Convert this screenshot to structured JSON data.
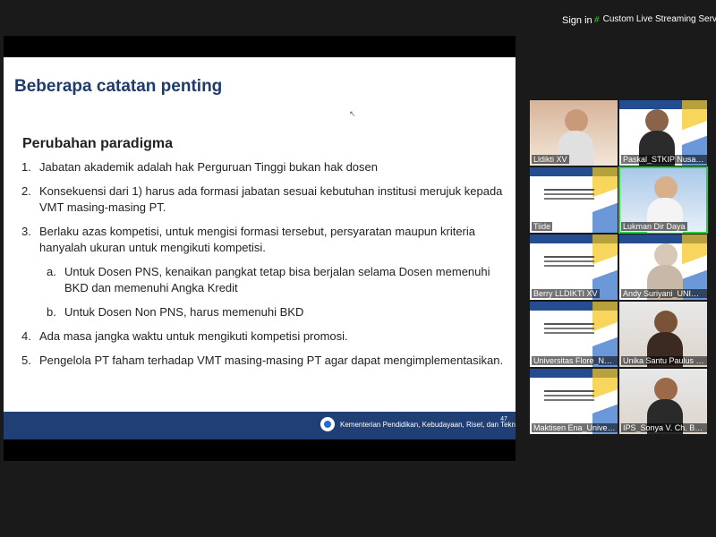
{
  "top_bar": {
    "signin_label": "Sign in",
    "live_label": "Custom Live Streaming Service",
    "live_icon": "signal-wave-icon",
    "chevron_icon": "chevron-down-icon"
  },
  "slide": {
    "title": "Beberapa catatan penting",
    "subtitle": "Perubahan paradigma",
    "items": [
      {
        "num": "1.",
        "text": "Jabatan akademik adalah hak Perguruan Tinggi bukan hak dosen"
      },
      {
        "num": "2.",
        "text": "Konsekuensi dari 1) harus ada formasi jabatan sesuai kebutuhan institusi merujuk kepada VMT masing-masing PT."
      },
      {
        "num": "3.",
        "text": "Berlaku azas kompetisi, untuk mengisi formasi tersebut, persyaratan maupun kriteria hanyalah ukuran untuk mengikuti kompetisi."
      },
      {
        "num": "4.",
        "text": "Ada masa jangka waktu untuk mengikuti kompetisi promosi."
      },
      {
        "num": "5.",
        "text": "Pengelola PT faham terhadap VMT masing-masing PT agar dapat mengimplementasikan."
      }
    ],
    "subitems": [
      {
        "num": "a.",
        "text": "Untuk Dosen PNS, kenaikan pangkat tetap bisa berjalan selama Dosen memenuhi BKD dan memenuhi Angka Kredit"
      },
      {
        "num": "b.",
        "text": "Untuk Dosen Non PNS, harus memenuhi BKD"
      }
    ],
    "footer_text": "Kementerian Pendidikan, Kebudayaan, Riset, dan Teknologi",
    "page_number": "47"
  },
  "participants": [
    {
      "name": "Lldikti XV"
    },
    {
      "name": "Paskal_STKIP Nusa Tim..."
    },
    {
      "name": "Tiide"
    },
    {
      "name": "Lukman Dir Daya"
    },
    {
      "name": "Berry LLDIKTI XV"
    },
    {
      "name": "Andy Suriyani_UNIMOF"
    },
    {
      "name": "Universitas Flore_Nat..."
    },
    {
      "name": "Unika Santu Paulus Ru..."
    },
    {
      "name": "Maktisen Ena_Universi..."
    },
    {
      "name": "IPS_Sonya V. Ch. Benu"
    }
  ],
  "colors": {
    "accent_active": "#2ecc40",
    "slide_title": "#1f3a6b",
    "footer_bg": "#1f3f75"
  }
}
